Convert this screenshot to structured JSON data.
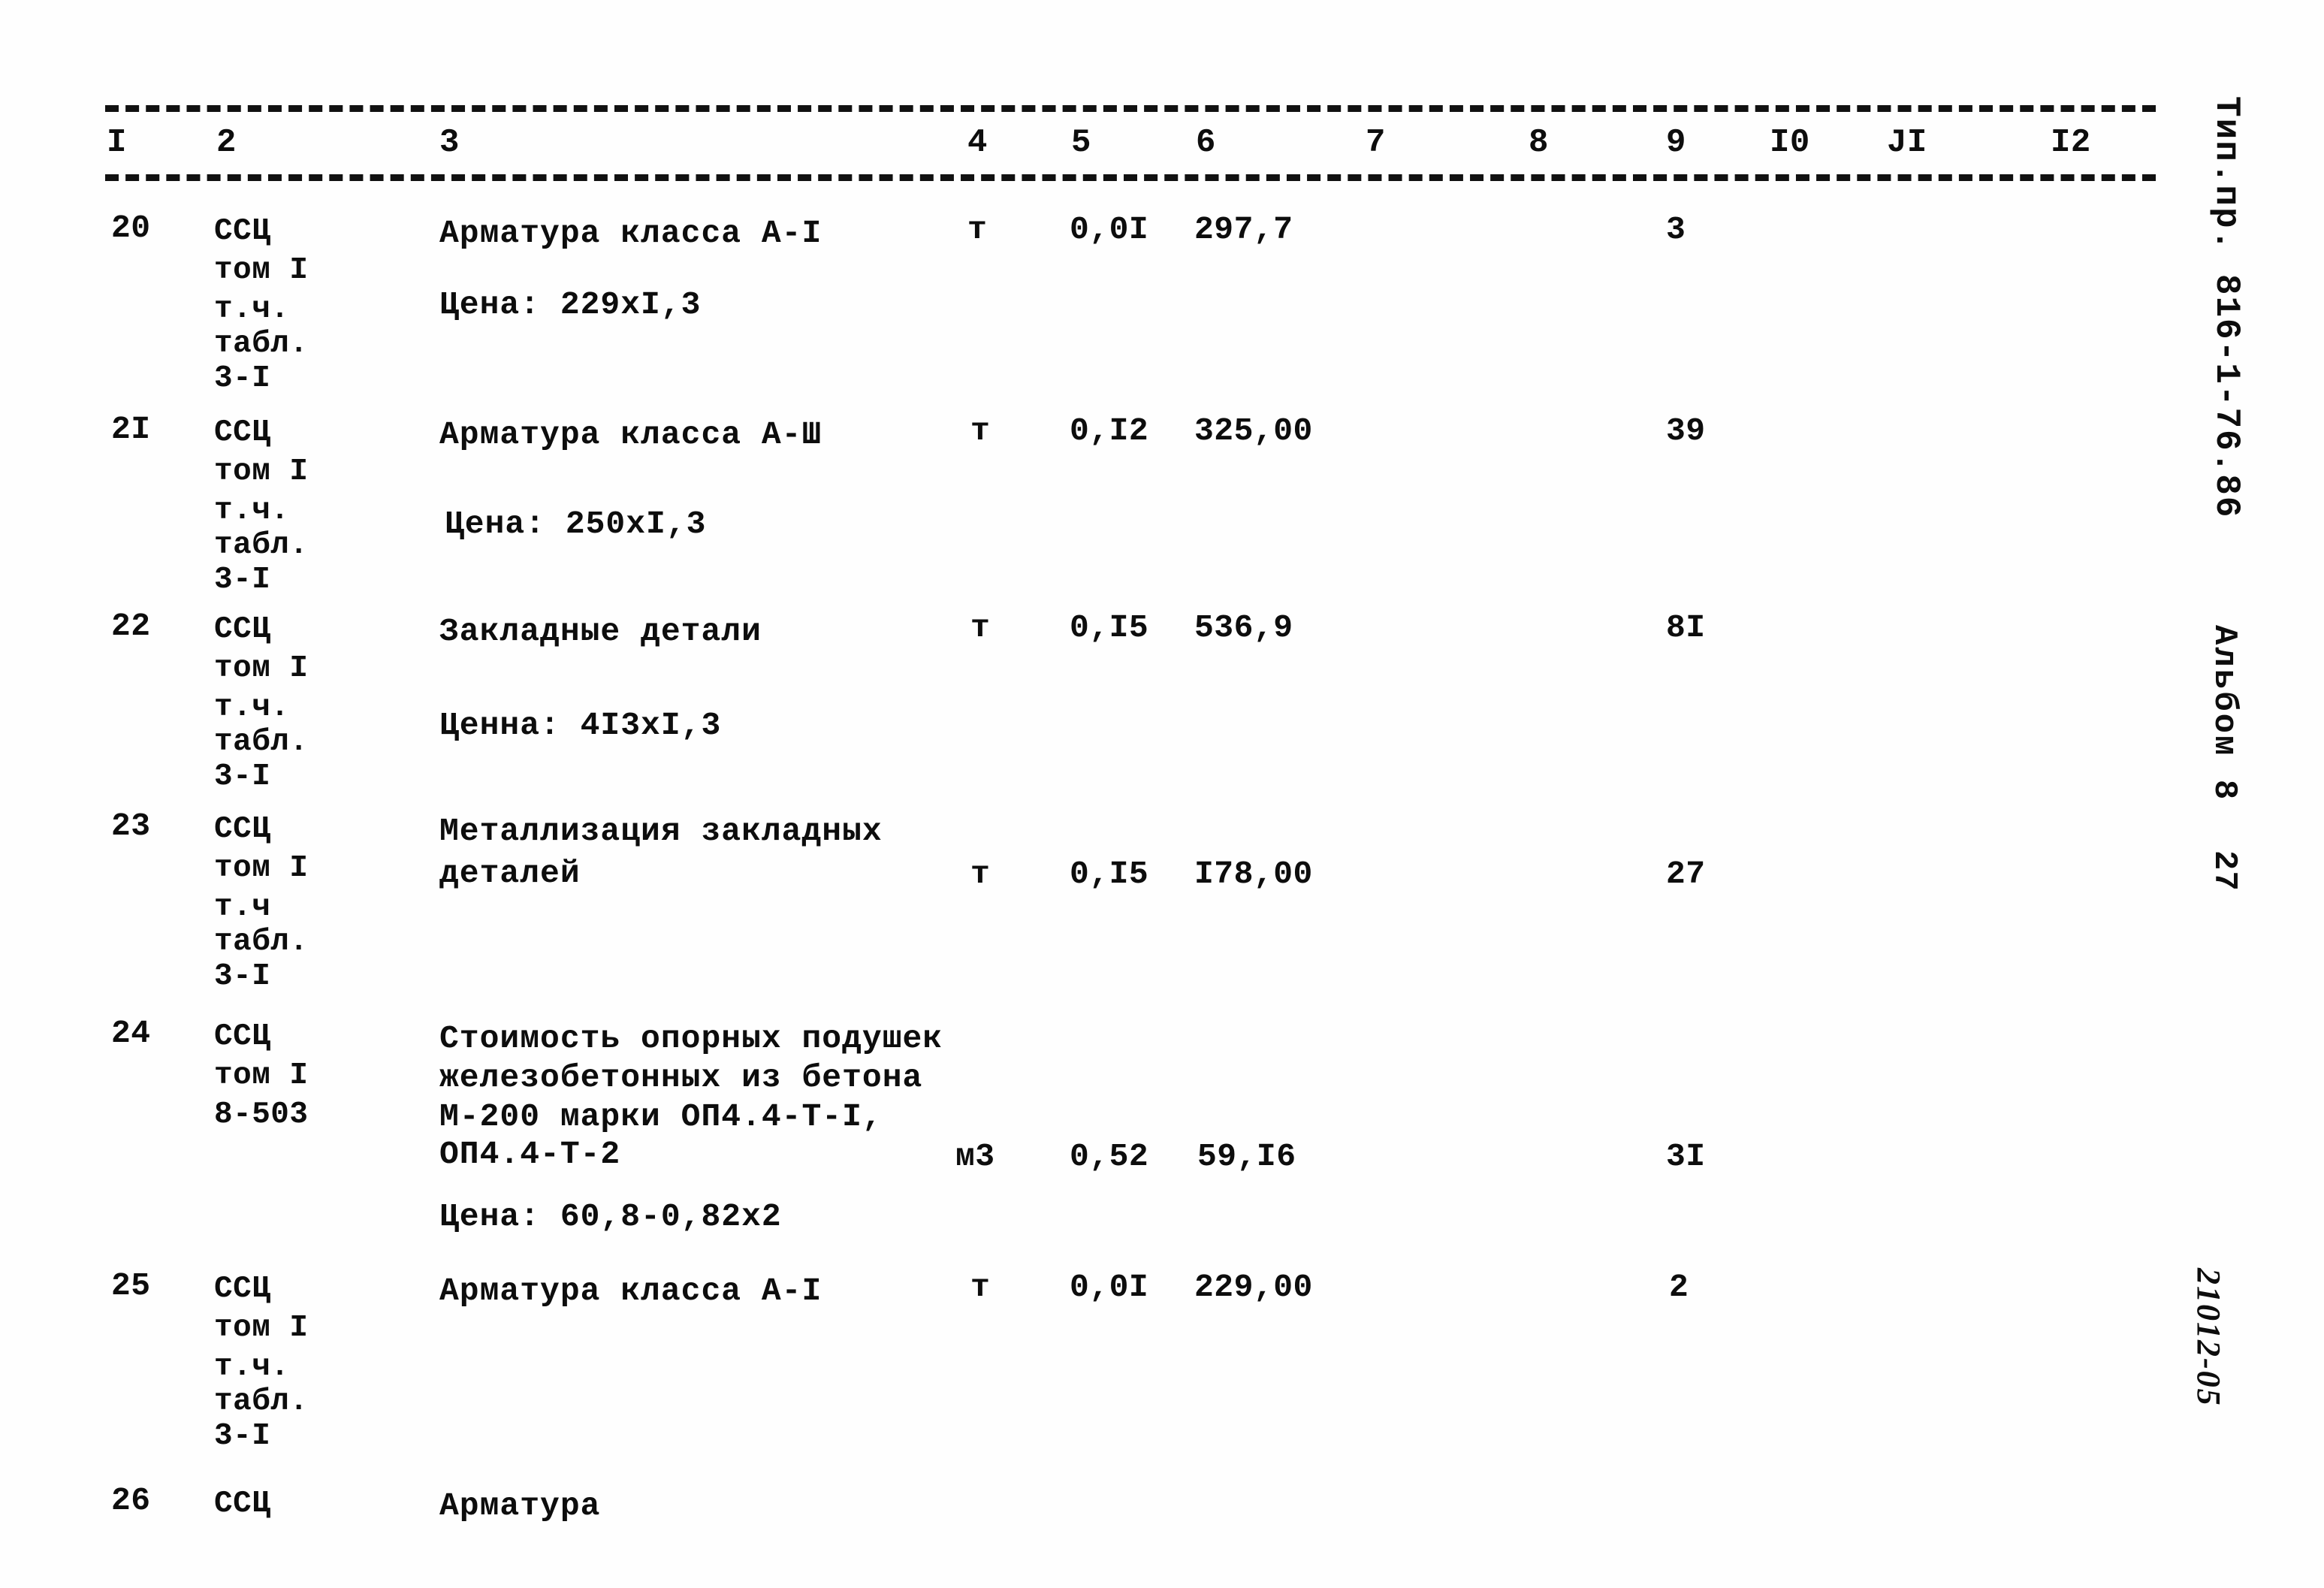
{
  "document": {
    "type": "estimate-table-page",
    "side_stamps": {
      "project": "Тип.пр. 816-1-76.86",
      "album": "Альбом 8",
      "page_number": "27",
      "code": "21012-05"
    }
  },
  "table": {
    "column_headers": [
      "I",
      "2",
      "3",
      "4",
      "5",
      "6",
      "7",
      "8",
      "9",
      "I0",
      "JI",
      "I2"
    ],
    "rows": [
      {
        "no": "20",
        "reference": [
          "ССЦ",
          "том I",
          "т.ч.",
          "табл.",
          "3-I"
        ],
        "description": [
          "Арматура класса А-I"
        ],
        "price_note": "Цена: 229xI,3",
        "unit": "т",
        "quantity": "0,0I",
        "unit_price": "297,7",
        "col7": "",
        "col8": "",
        "col9": "3",
        "col10": "",
        "col11": "",
        "col12": ""
      },
      {
        "no": "2I",
        "reference": [
          "ССЦ",
          "том I",
          "т.ч.",
          "табл.",
          "3-I"
        ],
        "description": [
          "Арматура класса А-Ш"
        ],
        "price_note": "Цена: 250xI,3",
        "unit": "т",
        "quantity": "0,I2",
        "unit_price": "325,00",
        "col7": "",
        "col8": "",
        "col9": "39",
        "col10": "",
        "col11": "",
        "col12": ""
      },
      {
        "no": "22",
        "reference": [
          "ССЦ",
          "том I",
          "т.ч.",
          "табл.",
          "3-I"
        ],
        "description": [
          "Закладные детали"
        ],
        "price_note": "Ценна: 4I3xI,3",
        "unit": "т",
        "quantity": "0,I5",
        "unit_price": "536,9",
        "col7": "",
        "col8": "",
        "col9": "8I",
        "col10": "",
        "col11": "",
        "col12": ""
      },
      {
        "no": "23",
        "reference": [
          "ССЦ",
          "том I",
          "т.ч",
          "табл.",
          "3-I"
        ],
        "description": [
          "Металлизация закладных",
          "деталей"
        ],
        "price_note": "",
        "unit": "т",
        "quantity": "0,I5",
        "unit_price": "I78,00",
        "col7": "",
        "col8": "",
        "col9": "27",
        "col10": "",
        "col11": "",
        "col12": ""
      },
      {
        "no": "24",
        "reference": [
          "ССЦ",
          "том I",
          "8-503"
        ],
        "description": [
          "Стоимость опорных подушек",
          "железобетонных из бетона",
          "М-200 марки ОП4.4-Т-I,",
          "ОП4.4-Т-2"
        ],
        "price_note": "Цена: 60,8-0,82x2",
        "unit": "м3",
        "quantity": "0,52",
        "unit_price": "59,I6",
        "col7": "",
        "col8": "",
        "col9": "3I",
        "col10": "",
        "col11": "",
        "col12": ""
      },
      {
        "no": "25",
        "reference": [
          "ССЦ",
          "том I",
          "т.ч.",
          "табл.",
          "3-I"
        ],
        "description": [
          "Арматура класса А-I"
        ],
        "price_note": "",
        "unit": "т",
        "quantity": "0,0I",
        "unit_price": "229,00",
        "col7": "",
        "col8": "",
        "col9": "2",
        "col10": "",
        "col11": "",
        "col12": ""
      },
      {
        "no": "26",
        "reference": [
          "ССЦ"
        ],
        "description": [
          "Арматура"
        ],
        "price_note": "",
        "unit": "",
        "quantity": "",
        "unit_price": "",
        "col7": "",
        "col8": "",
        "col9": "",
        "col10": "",
        "col11": "",
        "col12": ""
      }
    ]
  }
}
